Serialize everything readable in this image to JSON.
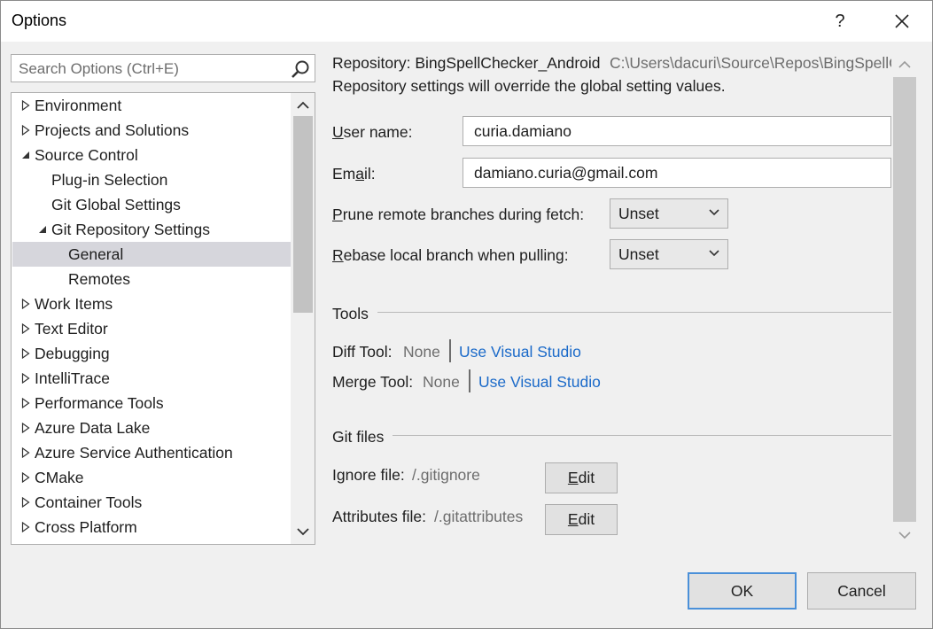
{
  "window": {
    "title": "Options",
    "help": "?",
    "close": "✕"
  },
  "search": {
    "placeholder": "Search Options (Ctrl+E)"
  },
  "tree": {
    "items": [
      {
        "label": "Environment",
        "expanded": false,
        "level": 0
      },
      {
        "label": "Projects and Solutions",
        "expanded": false,
        "level": 0
      },
      {
        "label": "Source Control",
        "expanded": true,
        "level": 0
      },
      {
        "label": "Plug-in Selection",
        "level": 1
      },
      {
        "label": "Git Global Settings",
        "level": 1
      },
      {
        "label": "Git Repository Settings",
        "expanded": true,
        "level": 1
      },
      {
        "label": "General",
        "level": 2,
        "selected": true
      },
      {
        "label": "Remotes",
        "level": 2
      },
      {
        "label": "Work Items",
        "expanded": false,
        "level": 0
      },
      {
        "label": "Text Editor",
        "expanded": false,
        "level": 0
      },
      {
        "label": "Debugging",
        "expanded": false,
        "level": 0
      },
      {
        "label": "IntelliTrace",
        "expanded": false,
        "level": 0
      },
      {
        "label": "Performance Tools",
        "expanded": false,
        "level": 0
      },
      {
        "label": "Azure Data Lake",
        "expanded": false,
        "level": 0
      },
      {
        "label": "Azure Service Authentication",
        "expanded": false,
        "level": 0
      },
      {
        "label": "CMake",
        "expanded": false,
        "level": 0
      },
      {
        "label": "Container Tools",
        "expanded": false,
        "level": 0
      },
      {
        "label": "Cross Platform",
        "expanded": false,
        "level": 0
      }
    ]
  },
  "repo": {
    "label": "Repository: BingSpellChecker_Android",
    "path": "C:\\Users\\dacuri\\Source\\Repos\\BingSpellC",
    "note": "Repository settings will override the global setting values."
  },
  "form": {
    "username_label_first": "U",
    "username_label_rest": "ser name:",
    "username_value": "curia.damiano",
    "email_label_first": "Em",
    "email_label_mid": "a",
    "email_label_rest": "il:",
    "email_value": "damiano.curia@gmail.com",
    "prune_label_first": "P",
    "prune_label_rest": "rune remote branches during fetch:",
    "prune_value": "Unset",
    "rebase_label_first": "R",
    "rebase_label_rest": "ebase local branch when pulling:",
    "rebase_value": "Unset"
  },
  "tools": {
    "heading": "Tools",
    "diff_label": "Diff Tool:",
    "diff_value": "None",
    "diff_link": "Use Visual Studio",
    "merge_label": "Merge Tool:",
    "merge_value": "None",
    "merge_link": "Use Visual Studio"
  },
  "gitfiles": {
    "heading": "Git files",
    "ignore_label": "Ignore file:",
    "ignore_value": "/.gitignore",
    "attributes_label": "Attributes file:",
    "attributes_value": "/.gitattributes",
    "edit_first": "E",
    "edit_rest": "dit"
  },
  "footer": {
    "ok": "OK",
    "cancel": "Cancel"
  }
}
